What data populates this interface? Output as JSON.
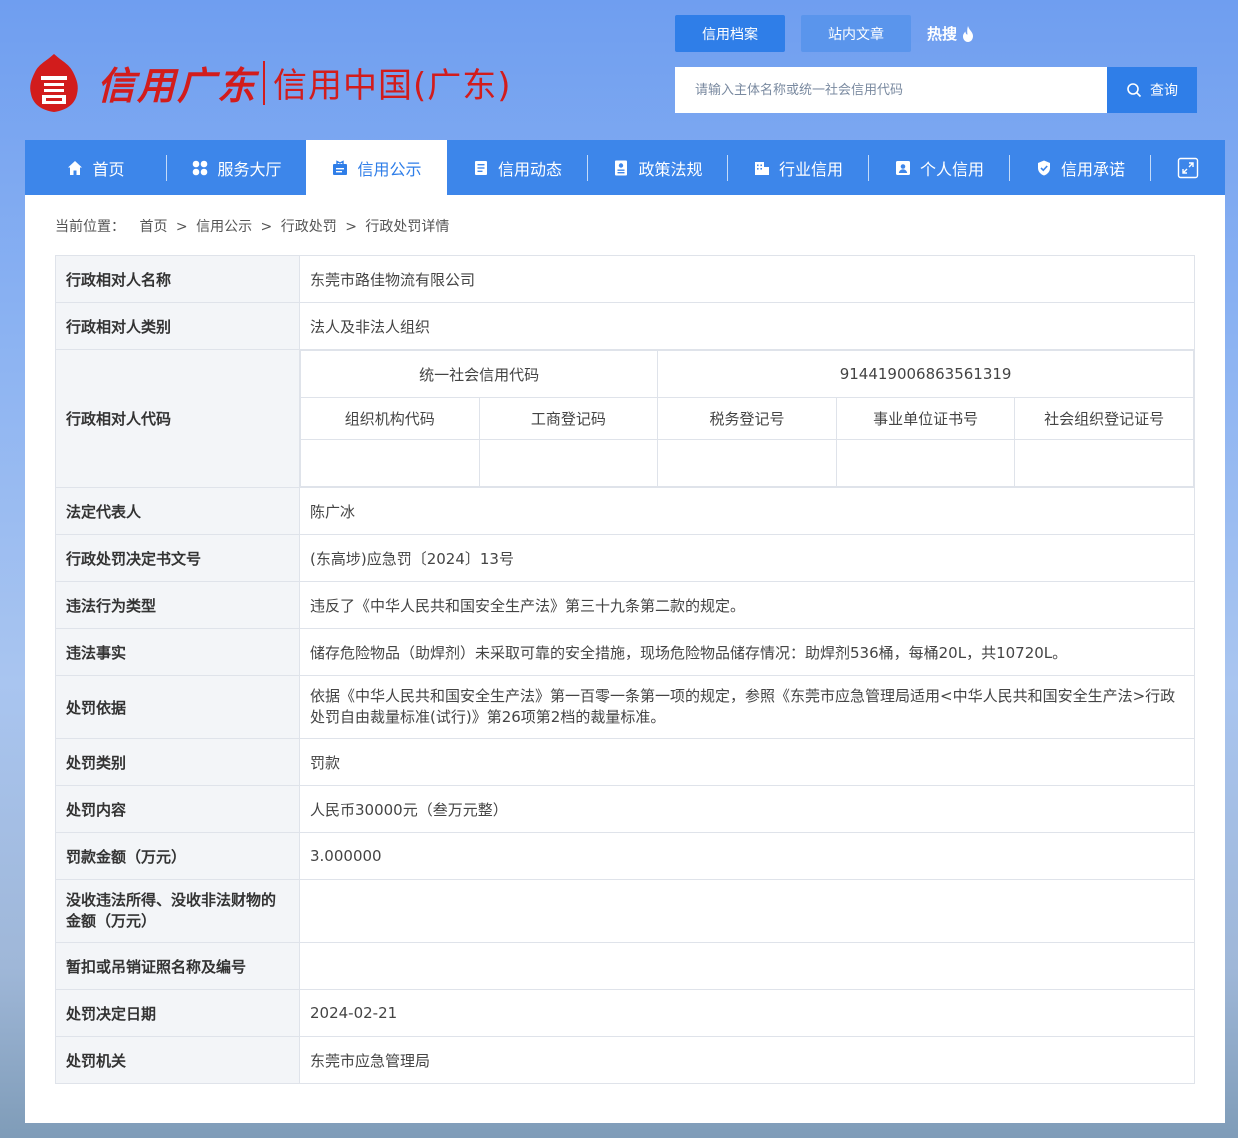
{
  "header": {
    "logo_script": "信用广东",
    "logo_text": "信用中国(广东)",
    "tabs": [
      {
        "label": "信用档案",
        "active": true
      },
      {
        "label": "站内文章",
        "active": false
      }
    ],
    "hot_label": "热搜",
    "search": {
      "placeholder": "请输入主体名称或统一社会信用代码",
      "button": "查询"
    }
  },
  "nav": {
    "items": [
      {
        "label": "首页",
        "icon": "home-icon"
      },
      {
        "label": "服务大厅",
        "icon": "apps-icon"
      },
      {
        "label": "信用公示",
        "icon": "publicity-icon",
        "active": true
      },
      {
        "label": "信用动态",
        "icon": "news-icon"
      },
      {
        "label": "政策法规",
        "icon": "law-icon"
      },
      {
        "label": "行业信用",
        "icon": "building-icon"
      },
      {
        "label": "个人信用",
        "icon": "id-card-icon"
      },
      {
        "label": "信用承诺",
        "icon": "shield-icon"
      }
    ],
    "expand_icon": "expand-icon"
  },
  "breadcrumb": {
    "prefix": "当前位置：",
    "items": [
      "首页",
      "信用公示",
      "行政处罚",
      "行政处罚详情"
    ],
    "separator": ">"
  },
  "detail": {
    "name_label": "行政相对人名称",
    "name_value": "东莞市路佳物流有限公司",
    "type_label": "行政相对人类别",
    "type_value": "法人及非法人组织",
    "code_label": "行政相对人代码",
    "uscc_label": "统一社会信用代码",
    "uscc_value": "914419006863561319",
    "code_headers": [
      "组织机构代码",
      "工商登记码",
      "税务登记号",
      "事业单位证书号",
      "社会组织登记证号"
    ],
    "code_values": [
      "",
      "",
      "",
      "",
      ""
    ],
    "rep_label": "法定代表人",
    "rep_value": "陈广冰",
    "doc_label": "行政处罚决定书文号",
    "doc_value": "(东高埗)应急罚〔2024〕13号",
    "vio_type_label": "违法行为类型",
    "vio_type_value": "违反了《中华人民共和国安全生产法》第三十九条第二款的规定。",
    "fact_label": "违法事实",
    "fact_value": "储存危险物品（助焊剂）未采取可靠的安全措施，现场危险物品储存情况：助焊剂536桶，每桶20L，共10720L。",
    "basis_label": "处罚依据",
    "basis_value": "依据《中华人民共和国安全生产法》第一百零一条第一项的规定，参照《东莞市应急管理局适用<中华人民共和国安全生产法>行政处罚自由裁量标准(试行)》第26项第2档的裁量标准。",
    "ptype_label": "处罚类别",
    "ptype_value": "罚款",
    "content_label": "处罚内容",
    "content_value": "人民币30000元（叁万元整）",
    "amount_label": "罚款金额（万元）",
    "amount_value": "3.000000",
    "confiscate_label": "没收违法所得、没收非法财物的金额（万元）",
    "confiscate_value": "",
    "license_label": "暂扣或吊销证照名称及编号",
    "license_value": "",
    "date_label": "处罚决定日期",
    "date_value": "2024-02-21",
    "org_label": "处罚机关",
    "org_value": "东莞市应急管理局"
  },
  "colors": {
    "primary": "#3d86ea",
    "logo_red": "#d21c1c"
  }
}
